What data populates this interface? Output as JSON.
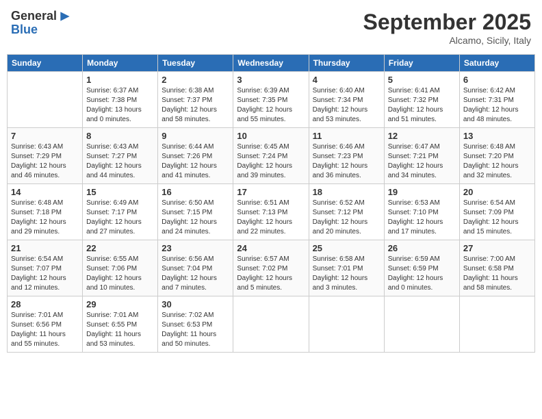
{
  "header": {
    "logo_general": "General",
    "logo_blue": "Blue",
    "month_title": "September 2025",
    "location": "Alcamo, Sicily, Italy"
  },
  "days_of_week": [
    "Sunday",
    "Monday",
    "Tuesday",
    "Wednesday",
    "Thursday",
    "Friday",
    "Saturday"
  ],
  "weeks": [
    [
      {
        "day": "",
        "info": ""
      },
      {
        "day": "1",
        "info": "Sunrise: 6:37 AM\nSunset: 7:38 PM\nDaylight: 13 hours\nand 0 minutes."
      },
      {
        "day": "2",
        "info": "Sunrise: 6:38 AM\nSunset: 7:37 PM\nDaylight: 12 hours\nand 58 minutes."
      },
      {
        "day": "3",
        "info": "Sunrise: 6:39 AM\nSunset: 7:35 PM\nDaylight: 12 hours\nand 55 minutes."
      },
      {
        "day": "4",
        "info": "Sunrise: 6:40 AM\nSunset: 7:34 PM\nDaylight: 12 hours\nand 53 minutes."
      },
      {
        "day": "5",
        "info": "Sunrise: 6:41 AM\nSunset: 7:32 PM\nDaylight: 12 hours\nand 51 minutes."
      },
      {
        "day": "6",
        "info": "Sunrise: 6:42 AM\nSunset: 7:31 PM\nDaylight: 12 hours\nand 48 minutes."
      }
    ],
    [
      {
        "day": "7",
        "info": "Sunrise: 6:43 AM\nSunset: 7:29 PM\nDaylight: 12 hours\nand 46 minutes."
      },
      {
        "day": "8",
        "info": "Sunrise: 6:43 AM\nSunset: 7:27 PM\nDaylight: 12 hours\nand 44 minutes."
      },
      {
        "day": "9",
        "info": "Sunrise: 6:44 AM\nSunset: 7:26 PM\nDaylight: 12 hours\nand 41 minutes."
      },
      {
        "day": "10",
        "info": "Sunrise: 6:45 AM\nSunset: 7:24 PM\nDaylight: 12 hours\nand 39 minutes."
      },
      {
        "day": "11",
        "info": "Sunrise: 6:46 AM\nSunset: 7:23 PM\nDaylight: 12 hours\nand 36 minutes."
      },
      {
        "day": "12",
        "info": "Sunrise: 6:47 AM\nSunset: 7:21 PM\nDaylight: 12 hours\nand 34 minutes."
      },
      {
        "day": "13",
        "info": "Sunrise: 6:48 AM\nSunset: 7:20 PM\nDaylight: 12 hours\nand 32 minutes."
      }
    ],
    [
      {
        "day": "14",
        "info": "Sunrise: 6:48 AM\nSunset: 7:18 PM\nDaylight: 12 hours\nand 29 minutes."
      },
      {
        "day": "15",
        "info": "Sunrise: 6:49 AM\nSunset: 7:17 PM\nDaylight: 12 hours\nand 27 minutes."
      },
      {
        "day": "16",
        "info": "Sunrise: 6:50 AM\nSunset: 7:15 PM\nDaylight: 12 hours\nand 24 minutes."
      },
      {
        "day": "17",
        "info": "Sunrise: 6:51 AM\nSunset: 7:13 PM\nDaylight: 12 hours\nand 22 minutes."
      },
      {
        "day": "18",
        "info": "Sunrise: 6:52 AM\nSunset: 7:12 PM\nDaylight: 12 hours\nand 20 minutes."
      },
      {
        "day": "19",
        "info": "Sunrise: 6:53 AM\nSunset: 7:10 PM\nDaylight: 12 hours\nand 17 minutes."
      },
      {
        "day": "20",
        "info": "Sunrise: 6:54 AM\nSunset: 7:09 PM\nDaylight: 12 hours\nand 15 minutes."
      }
    ],
    [
      {
        "day": "21",
        "info": "Sunrise: 6:54 AM\nSunset: 7:07 PM\nDaylight: 12 hours\nand 12 minutes."
      },
      {
        "day": "22",
        "info": "Sunrise: 6:55 AM\nSunset: 7:06 PM\nDaylight: 12 hours\nand 10 minutes."
      },
      {
        "day": "23",
        "info": "Sunrise: 6:56 AM\nSunset: 7:04 PM\nDaylight: 12 hours\nand 7 minutes."
      },
      {
        "day": "24",
        "info": "Sunrise: 6:57 AM\nSunset: 7:02 PM\nDaylight: 12 hours\nand 5 minutes."
      },
      {
        "day": "25",
        "info": "Sunrise: 6:58 AM\nSunset: 7:01 PM\nDaylight: 12 hours\nand 3 minutes."
      },
      {
        "day": "26",
        "info": "Sunrise: 6:59 AM\nSunset: 6:59 PM\nDaylight: 12 hours\nand 0 minutes."
      },
      {
        "day": "27",
        "info": "Sunrise: 7:00 AM\nSunset: 6:58 PM\nDaylight: 11 hours\nand 58 minutes."
      }
    ],
    [
      {
        "day": "28",
        "info": "Sunrise: 7:01 AM\nSunset: 6:56 PM\nDaylight: 11 hours\nand 55 minutes."
      },
      {
        "day": "29",
        "info": "Sunrise: 7:01 AM\nSunset: 6:55 PM\nDaylight: 11 hours\nand 53 minutes."
      },
      {
        "day": "30",
        "info": "Sunrise: 7:02 AM\nSunset: 6:53 PM\nDaylight: 11 hours\nand 50 minutes."
      },
      {
        "day": "",
        "info": ""
      },
      {
        "day": "",
        "info": ""
      },
      {
        "day": "",
        "info": ""
      },
      {
        "day": "",
        "info": ""
      }
    ]
  ]
}
